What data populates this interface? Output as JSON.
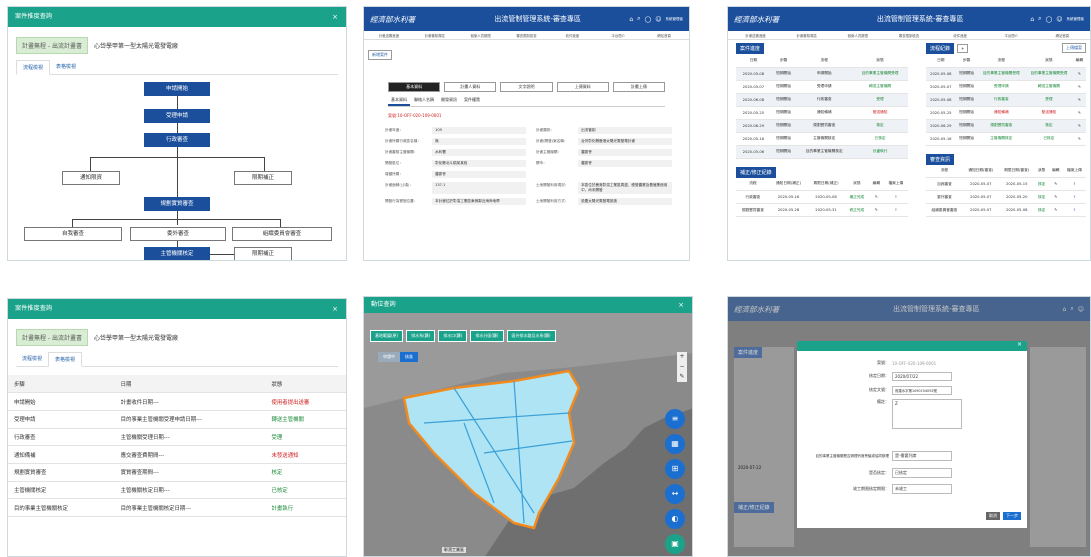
{
  "common": {
    "modal_title": "案件推度查詢",
    "project_tag": "計畫無程 - 出流計畫書",
    "project_name": "心岱學甲第一型太陽光電發電廠",
    "tab_flow": "流程檢視",
    "tab_table": "表格檢視",
    "close": "×"
  },
  "flow": {
    "n1": "申請開始",
    "n2": "受理申請",
    "n3": "行政審查",
    "n4": "通知限資",
    "n5": "限期補正",
    "n6": "規劃實質審查",
    "n7": "自我審查",
    "n8": "委外審查",
    "n9": "組織委員會審查",
    "n10": "主管機關核定",
    "n11": "限期補正"
  },
  "steps_table": {
    "headers": [
      "步驟",
      "日期",
      "狀態"
    ],
    "rows": [
      {
        "step": "申請開始",
        "date": "計畫收件日期---",
        "status": "使用者提出送審",
        "color": "r"
      },
      {
        "step": "受理申請",
        "date": "目的事業主管機關受理申請日期---",
        "status": "轉送主管機關",
        "color": "g"
      },
      {
        "step": "行政審查",
        "date": "主管機關受理日期---",
        "status": "受理",
        "color": "g"
      },
      {
        "step": "通知備補",
        "date": "應交審查費期間---",
        "status": "未發送通知",
        "color": "r"
      },
      {
        "step": "規劃實質審查",
        "date": "實質審查期間---",
        "status": "核定",
        "color": "g"
      },
      {
        "step": "主管機關核定",
        "date": "主管機關核定日期---",
        "status": "已核定",
        "color": "g"
      },
      {
        "step": "目的事業主管機關核定",
        "date": "目的事業主管機關核定日期---",
        "status": "計畫執行",
        "color": "g"
      }
    ]
  },
  "sys": {
    "logo": "經濟部水利署",
    "title": "出流管制管理系統-審查專區",
    "user": "系統管理者"
  },
  "nav": [
    "計畫送審進度",
    "計畫審核專區",
    "個案人員權限",
    "審查限制檢查",
    "收件進度",
    "平台簡介",
    "網站首頁"
  ],
  "detail": {
    "add_btn": "新增案件",
    "tabs": [
      "基本資料",
      "計畫人資料",
      "文字說明",
      "上傳資料",
      "計畫上傳"
    ],
    "subtabs": [
      "基本資料",
      "聯絡人名稱",
      "開發資訊",
      "案件權責"
    ],
    "case_no": "案號:10-OFF-020-109-0001",
    "fields": [
      {
        "l": "計畫年度：",
        "v": "109",
        "l2": "計畫類別：",
        "v2": "出流管制"
      },
      {
        "l": "計畫所屬行政區名稱：",
        "v": "無",
        "l2": "計畫(開發)案名稱：",
        "v2": "台灣彰化縣鹿港太陽光電發電計畫"
      },
      {
        "l": "計畫審核主管機關：",
        "v": "水利署",
        "l2": "計畫主管機關：",
        "v2": "農委會"
      },
      {
        "l": "開發區位：",
        "v": "彰化縣北斗鎮某某段",
        "l2": "縣市：",
        "v2": "農委會"
      },
      {
        "l": "增額所屬：",
        "v": "農委會",
        "l2": "",
        "v2": ""
      },
      {
        "l": "計畫面積(公頃)：",
        "v": "137.1",
        "l2": "土地開發利用現況：",
        "v2": "本區位於鹿港彰濱工業區周邊，經營農業及養殖業使用中，尚未開發"
      },
      {
        "l": "開發行為實施位置：",
        "v": "本計畫位於彰濱工業區東側鄰近海岸地帶",
        "l2": "土地開發利用方式：",
        "v2": "設置太陽光電發電設施"
      }
    ]
  },
  "progress": {
    "case_section": "案件進度",
    "flow_section": "流程紀錄",
    "upload": "上傳檔案",
    "case_headers": [
      "日期",
      "步驟",
      "流程",
      "狀態"
    ],
    "case_rows": [
      [
        "2020-05-08",
        "短期開始",
        "申請開始",
        "目的事業主管機關受理"
      ],
      [
        "2020-05-07",
        "短期開始",
        "受理申請",
        "轉送主管機關"
      ],
      [
        "2020-06-08",
        "短期開始",
        "行政審查",
        "受理"
      ],
      [
        "2020-05-25",
        "短期開始",
        "通知備補",
        "發送通知"
      ],
      [
        "2020-06-29",
        "短期開始",
        "規劃實質審查",
        "核定"
      ],
      [
        "2020-05-16",
        "短期開始",
        "主管機關核定",
        "已核定"
      ],
      [
        "2020-05-06",
        "短期開始",
        "目的事業主管機關核定",
        "計畫執行"
      ]
    ],
    "flow_headers": [
      "日期",
      "步驟",
      "流程",
      "狀態",
      "編輯"
    ],
    "flow_rows": [
      [
        "2020-05-08",
        "短期開始",
        "目的事業主管機關受理",
        "目的事業主管機關受理"
      ],
      [
        "2020-05-07",
        "短期開始",
        "受理申請",
        "轉送主管機關"
      ],
      [
        "2020-05-08",
        "短期開始",
        "行政審查",
        "受理"
      ],
      [
        "2020-05-25",
        "短期開始",
        "通知備補",
        "發送通知"
      ],
      [
        "2020-06-29",
        "短期開始",
        "規劃實質審查",
        "核定"
      ],
      [
        "2020-05-16",
        "短期開始",
        "主管機關核定",
        "已核定"
      ]
    ],
    "correct_section": "補正/修正紀錄",
    "review_section": "審查資訊",
    "correct_headers": [
      "流程",
      "通知日期(補正)",
      "期限日期(補正)",
      "狀態",
      "編輯",
      "檔案上傳"
    ],
    "correct_rows": [
      [
        "行政審查",
        "2020-05-16",
        "2020-05-08",
        "補正完成"
      ],
      [
        "規劃實質審查",
        "2020-05-28",
        "2020-05-31",
        "修正完成"
      ]
    ],
    "review_headers": [
      "流程",
      "通知日期(審查)",
      "期限日期(審查)",
      "狀態",
      "編輯",
      "檔案上傳"
    ],
    "review_rows": [
      [
        "自我審查",
        "2020-05-07",
        "2020-05-15",
        "核定"
      ],
      [
        "委外審查",
        "2020-05-07",
        "2020-05-20",
        "核定"
      ],
      [
        "組織委員會審查",
        "2020-05-07",
        "2020-05-08",
        "核定"
      ]
    ]
  },
  "map": {
    "title": "動位查詢",
    "close": "×",
    "buttons": [
      "基地範圍(原)",
      "排水系(縣)",
      "排水口(縣)",
      "排水分區(縣)",
      "區外排水路及水系(縣)"
    ],
    "toggle1": "申請中",
    "toggle2": "核准",
    "footer": "彰濱工業區"
  },
  "dialog": {
    "case_label": "案號：",
    "case_val": "10-OFF-020-109-0001",
    "date_label": "核定日期：",
    "date_val": "2020/07/22",
    "doc_label": "核定文號：",
    "doc_val": "府建水字第1090154092號",
    "note_label": "備註：",
    "note_val": "Z",
    "select1_label": "目的事業主管機關是否辦理列席會議或協同辦理",
    "select1_val": "是-需要列席",
    "select2_label": "是否核定：",
    "select2_val": "已核定",
    "select3_label": "竣工期限核定期限：",
    "select3_val": "未竣工",
    "cancel": "取消",
    "submit": "下一步",
    "bg_date": "2020-07-22"
  }
}
